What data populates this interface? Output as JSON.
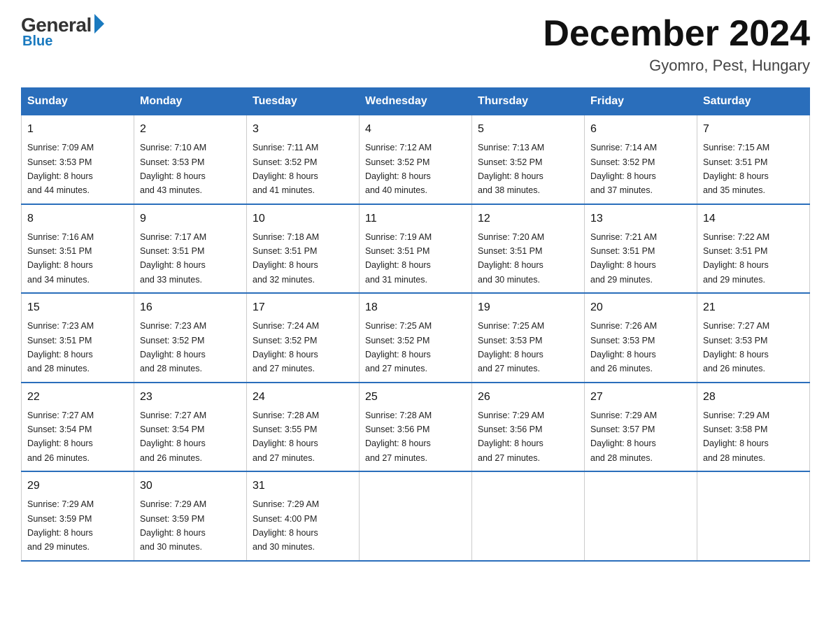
{
  "logo": {
    "general": "General",
    "blue": "Blue"
  },
  "header": {
    "title": "December 2024",
    "location": "Gyomro, Pest, Hungary"
  },
  "days_of_week": [
    "Sunday",
    "Monday",
    "Tuesday",
    "Wednesday",
    "Thursday",
    "Friday",
    "Saturday"
  ],
  "weeks": [
    [
      {
        "day": "1",
        "sunrise": "7:09 AM",
        "sunset": "3:53 PM",
        "daylight": "8 hours and 44 minutes."
      },
      {
        "day": "2",
        "sunrise": "7:10 AM",
        "sunset": "3:53 PM",
        "daylight": "8 hours and 43 minutes."
      },
      {
        "day": "3",
        "sunrise": "7:11 AM",
        "sunset": "3:52 PM",
        "daylight": "8 hours and 41 minutes."
      },
      {
        "day": "4",
        "sunrise": "7:12 AM",
        "sunset": "3:52 PM",
        "daylight": "8 hours and 40 minutes."
      },
      {
        "day": "5",
        "sunrise": "7:13 AM",
        "sunset": "3:52 PM",
        "daylight": "8 hours and 38 minutes."
      },
      {
        "day": "6",
        "sunrise": "7:14 AM",
        "sunset": "3:52 PM",
        "daylight": "8 hours and 37 minutes."
      },
      {
        "day": "7",
        "sunrise": "7:15 AM",
        "sunset": "3:51 PM",
        "daylight": "8 hours and 35 minutes."
      }
    ],
    [
      {
        "day": "8",
        "sunrise": "7:16 AM",
        "sunset": "3:51 PM",
        "daylight": "8 hours and 34 minutes."
      },
      {
        "day": "9",
        "sunrise": "7:17 AM",
        "sunset": "3:51 PM",
        "daylight": "8 hours and 33 minutes."
      },
      {
        "day": "10",
        "sunrise": "7:18 AM",
        "sunset": "3:51 PM",
        "daylight": "8 hours and 32 minutes."
      },
      {
        "day": "11",
        "sunrise": "7:19 AM",
        "sunset": "3:51 PM",
        "daylight": "8 hours and 31 minutes."
      },
      {
        "day": "12",
        "sunrise": "7:20 AM",
        "sunset": "3:51 PM",
        "daylight": "8 hours and 30 minutes."
      },
      {
        "day": "13",
        "sunrise": "7:21 AM",
        "sunset": "3:51 PM",
        "daylight": "8 hours and 29 minutes."
      },
      {
        "day": "14",
        "sunrise": "7:22 AM",
        "sunset": "3:51 PM",
        "daylight": "8 hours and 29 minutes."
      }
    ],
    [
      {
        "day": "15",
        "sunrise": "7:23 AM",
        "sunset": "3:51 PM",
        "daylight": "8 hours and 28 minutes."
      },
      {
        "day": "16",
        "sunrise": "7:23 AM",
        "sunset": "3:52 PM",
        "daylight": "8 hours and 28 minutes."
      },
      {
        "day": "17",
        "sunrise": "7:24 AM",
        "sunset": "3:52 PM",
        "daylight": "8 hours and 27 minutes."
      },
      {
        "day": "18",
        "sunrise": "7:25 AM",
        "sunset": "3:52 PM",
        "daylight": "8 hours and 27 minutes."
      },
      {
        "day": "19",
        "sunrise": "7:25 AM",
        "sunset": "3:53 PM",
        "daylight": "8 hours and 27 minutes."
      },
      {
        "day": "20",
        "sunrise": "7:26 AM",
        "sunset": "3:53 PM",
        "daylight": "8 hours and 26 minutes."
      },
      {
        "day": "21",
        "sunrise": "7:27 AM",
        "sunset": "3:53 PM",
        "daylight": "8 hours and 26 minutes."
      }
    ],
    [
      {
        "day": "22",
        "sunrise": "7:27 AM",
        "sunset": "3:54 PM",
        "daylight": "8 hours and 26 minutes."
      },
      {
        "day": "23",
        "sunrise": "7:27 AM",
        "sunset": "3:54 PM",
        "daylight": "8 hours and 26 minutes."
      },
      {
        "day": "24",
        "sunrise": "7:28 AM",
        "sunset": "3:55 PM",
        "daylight": "8 hours and 27 minutes."
      },
      {
        "day": "25",
        "sunrise": "7:28 AM",
        "sunset": "3:56 PM",
        "daylight": "8 hours and 27 minutes."
      },
      {
        "day": "26",
        "sunrise": "7:29 AM",
        "sunset": "3:56 PM",
        "daylight": "8 hours and 27 minutes."
      },
      {
        "day": "27",
        "sunrise": "7:29 AM",
        "sunset": "3:57 PM",
        "daylight": "8 hours and 28 minutes."
      },
      {
        "day": "28",
        "sunrise": "7:29 AM",
        "sunset": "3:58 PM",
        "daylight": "8 hours and 28 minutes."
      }
    ],
    [
      {
        "day": "29",
        "sunrise": "7:29 AM",
        "sunset": "3:59 PM",
        "daylight": "8 hours and 29 minutes."
      },
      {
        "day": "30",
        "sunrise": "7:29 AM",
        "sunset": "3:59 PM",
        "daylight": "8 hours and 30 minutes."
      },
      {
        "day": "31",
        "sunrise": "7:29 AM",
        "sunset": "4:00 PM",
        "daylight": "8 hours and 30 minutes."
      },
      null,
      null,
      null,
      null
    ]
  ],
  "labels": {
    "sunrise": "Sunrise:",
    "sunset": "Sunset:",
    "daylight": "Daylight:"
  }
}
